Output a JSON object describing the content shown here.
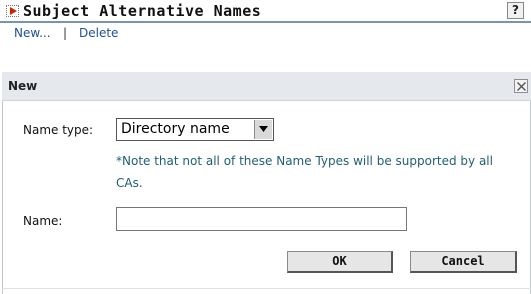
{
  "page_title": "Subject Alternative Names",
  "help_label": "?",
  "toolbar": {
    "new_label": "New...",
    "separator": "|",
    "delete_label": "Delete"
  },
  "dialog": {
    "title": "New",
    "name_type_label": "Name type:",
    "name_type_value": "Directory name",
    "note": "*Note that not all of these Name Types will be supported by all CAs.",
    "name_label": "Name:",
    "name_value": "",
    "ok_label": "OK",
    "cancel_label": "Cancel"
  },
  "icons": {
    "title_icon": "play-arrow-icon",
    "close_icon": "close-x-icon",
    "dropdown_icon": "chevron-down-icon"
  },
  "colors": {
    "link": "#1f4f99",
    "note_text": "#1f5f73",
    "dialog_header_bg": "#e5e9ee",
    "title_icon_red": "#cc2200"
  }
}
